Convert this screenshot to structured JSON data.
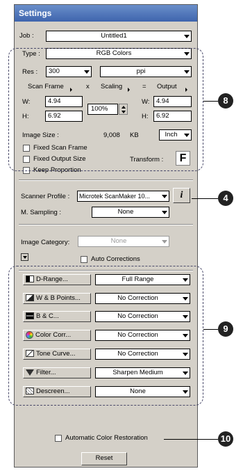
{
  "window": {
    "title": "Settings"
  },
  "job": {
    "label": "Job :",
    "value": "Untitled1"
  },
  "type": {
    "label": "Type :",
    "value": "RGB Colors"
  },
  "res": {
    "label": "Res :",
    "value": "300",
    "unit": "ppi"
  },
  "scan": {
    "col_scan": "Scan Frame",
    "col_x": "x",
    "col_scaling": "Scaling",
    "col_eq": "=",
    "col_output": "Output",
    "w_label": "W:",
    "h_label": "H:",
    "scan_w": "4.94",
    "scan_h": "6.92",
    "scaling": "100%",
    "out_w_label": "W:",
    "out_h_label": "H:",
    "out_w": "4.94",
    "out_h": "6.92"
  },
  "image_size": {
    "label": "Image Size :",
    "value": "9,008",
    "unit": "KB",
    "size_unit": "Inch"
  },
  "checks": {
    "fixed_scan_frame": "Fixed Scan Frame",
    "fixed_output_size": "Fixed Output Size",
    "keep_proportion": "Keep Proportion"
  },
  "transform": {
    "label": "Transform :",
    "button": "F"
  },
  "scanner_profile": {
    "label": "Scanner Profile :",
    "value": "Microtek ScanMaker 10...",
    "info": "i"
  },
  "m_sampling": {
    "label": "M. Sampling :",
    "value": "None"
  },
  "image_category": {
    "label": "Image Category:",
    "value": "None"
  },
  "auto_corrections": {
    "label": "Auto Corrections"
  },
  "tools": [
    {
      "label": "D-Range...",
      "value": "Full Range"
    },
    {
      "label": "W & B Points...",
      "value": "No Correction"
    },
    {
      "label": "B & C...",
      "value": "No Correction"
    },
    {
      "label": "Color Corr...",
      "value": "No Correction"
    },
    {
      "label": "Tone Curve...",
      "value": "No Correction"
    },
    {
      "label": "Filter...",
      "value": "Sharpen Medium"
    },
    {
      "label": "Descreen...",
      "value": "None"
    }
  ],
  "auto_color_restoration": {
    "label": "Automatic Color Restoration"
  },
  "reset": {
    "label": "Reset"
  },
  "callouts": {
    "c8": "8",
    "c4": "4",
    "c9": "9",
    "c10": "10"
  }
}
